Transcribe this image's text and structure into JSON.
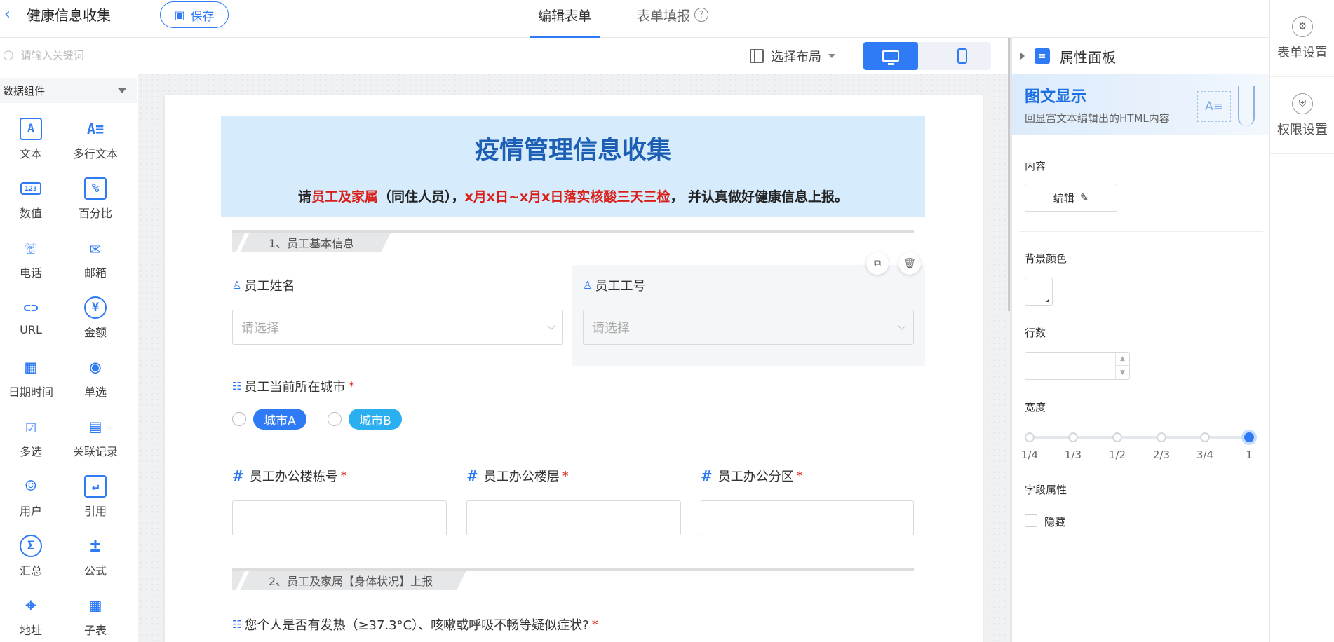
{
  "topbar": {
    "title": "健康信息收集",
    "save_label": "保存",
    "tabs": [
      {
        "label": "编辑表单",
        "active": true
      },
      {
        "label": "表单填报",
        "active": false
      }
    ]
  },
  "right_rail": {
    "items": [
      {
        "label": "表单设置",
        "icon": "form-settings-icon"
      },
      {
        "label": "权限设置",
        "icon": "shield-icon"
      }
    ]
  },
  "sidebar": {
    "search_placeholder": "请输入关键词",
    "group_title": "数据组件",
    "components": [
      {
        "label": "文本",
        "glyph": "A"
      },
      {
        "label": "多行文本",
        "glyph": "A≡"
      },
      {
        "label": "数值",
        "glyph": "123"
      },
      {
        "label": "百分比",
        "glyph": "%"
      },
      {
        "label": "电话",
        "glyph": "☏"
      },
      {
        "label": "邮箱",
        "glyph": "✉"
      },
      {
        "label": "URL",
        "glyph": "⊂⊃"
      },
      {
        "label": "金额",
        "glyph": "¥"
      },
      {
        "label": "日期时间",
        "glyph": "▦"
      },
      {
        "label": "单选",
        "glyph": "◉"
      },
      {
        "label": "多选",
        "glyph": "☑"
      },
      {
        "label": "关联记录",
        "glyph": "▤"
      },
      {
        "label": "用户",
        "glyph": "☺"
      },
      {
        "label": "引用",
        "glyph": "↵"
      },
      {
        "label": "汇总",
        "glyph": "Σ"
      },
      {
        "label": "公式",
        "glyph": "±"
      },
      {
        "label": "地址",
        "glyph": "⌖"
      },
      {
        "label": "子表",
        "glyph": "▦"
      }
    ]
  },
  "toolbar": {
    "layout_label": "选择布局",
    "device_active": "desktop"
  },
  "form": {
    "banner_title": "疫情管理信息收集",
    "banner_sub": {
      "part1": "请",
      "part2_red": "员工及家属",
      "part3": "（同住人员），",
      "part4_red": "x月x日~x月x日落实核酸三天三检",
      "part5": "， 并认真做好健康信息上报。"
    },
    "section1": "1、员工基本信息",
    "section2": "2、员工及家属【身体状况】上报",
    "fields": {
      "name_label": "员工姓名",
      "id_label": "员工工号",
      "select_placeholder": "请选择",
      "city_label": "员工当前所在城市",
      "city_options": [
        {
          "label": "城市A",
          "color": "#2f7bf5"
        },
        {
          "label": "城市B",
          "color": "#2ab0f0"
        }
      ],
      "building_label": "员工办公楼栋号",
      "floor_label": "员工办公楼层",
      "zone_label": "员工办公分区",
      "fever_label": "您个人是否有发热（≥37.3°C）、咳嗽或呼吸不畅等疑似症状?"
    }
  },
  "panel": {
    "header": "属性面板",
    "hero_title": "图文显示",
    "hero_sub": "回显富文本编辑出的HTML内容",
    "hero_art_glyph": "A≡",
    "content_label": "内容",
    "edit_label": "编辑",
    "bg_color_label": "背景颜色",
    "rows_label": "行数",
    "width_label": "宽度",
    "width_options": [
      "1/4",
      "1/3",
      "1/2",
      "2/3",
      "3/4",
      "1"
    ],
    "width_selected": "1",
    "field_props_label": "字段属性",
    "hidden_label": "隐藏"
  },
  "colors": {
    "accent": "#2f7bf5",
    "banner_bg": "#d6ebfb",
    "banner_title": "#1c5fb4",
    "required": "#d91e18"
  }
}
